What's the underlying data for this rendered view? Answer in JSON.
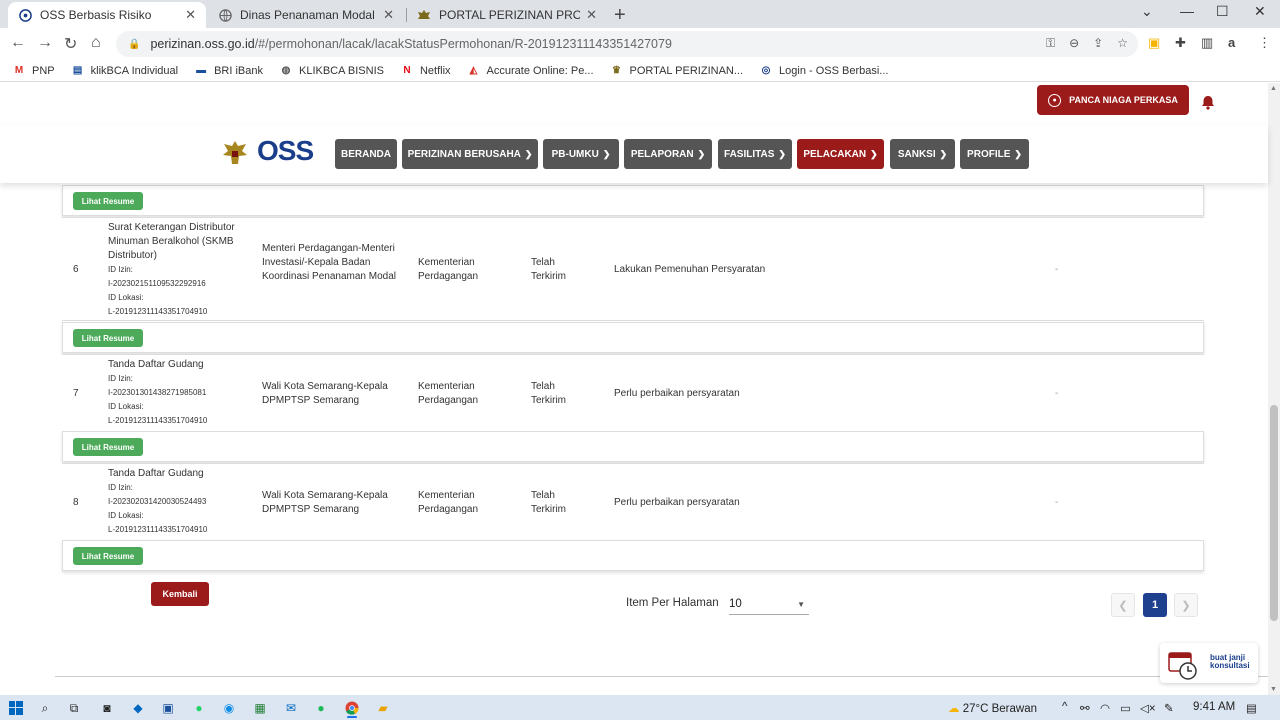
{
  "browser": {
    "tabs": [
      {
        "title": "OSS Berbasis Risiko",
        "active": true
      },
      {
        "title": "Dinas Penanaman Modal dan Pel",
        "active": false
      },
      {
        "title": "PORTAL PERIZINAN PROV JAWA",
        "active": false
      }
    ],
    "url_host": "perizinan.oss.go.id",
    "url_path": "/#/permohonan/lacak/lacakStatusPermohonan/R-201912311143351427079",
    "bookmarks": [
      "PNP",
      "klikBCA Individual",
      "BRI iBank",
      "KLIKBCA BISNIS",
      "Netflix",
      "Accurate Online: Pe...",
      "PORTAL PERIZINAN...",
      "Login - OSS Berbasi..."
    ]
  },
  "header": {
    "user_name": "PANCA NIAGA PERKASA",
    "logo_text": "OSS",
    "nav": [
      {
        "label": "BERANDA",
        "dropdown": false,
        "active": false
      },
      {
        "label": "PERIZINAN BERUSAHA",
        "dropdown": true,
        "active": false
      },
      {
        "label": "PB-UMKU",
        "dropdown": true,
        "active": false
      },
      {
        "label": "PELAPORAN",
        "dropdown": true,
        "active": false
      },
      {
        "label": "FASILITAS",
        "dropdown": true,
        "active": false
      },
      {
        "label": "PELACAKAN",
        "dropdown": true,
        "active": true
      },
      {
        "label": "SANKSI",
        "dropdown": true,
        "active": false
      },
      {
        "label": "PROFILE",
        "dropdown": true,
        "active": false
      }
    ]
  },
  "table": {
    "resume_label": "Lihat Resume",
    "rows": [
      {
        "no": "6",
        "name": "Surat Keterangan Distributor Minuman Beralkohol (SKMB Distributor)",
        "id_izin_label": "ID Izin:",
        "id_izin": "I-202302151109532292916",
        "id_lokasi_label": "ID Lokasi:",
        "id_lokasi": "L-201912311143351704910",
        "institution": "Menteri Perdagangan-Menteri Investasi/-Kepala Badan Koordinasi Penanaman Modal",
        "ministry": "Kementerian Perdagangan",
        "status": "Telah Terkirim",
        "note": "Lakukan Pemenuhan Persyaratan",
        "extra": "-"
      },
      {
        "no": "7",
        "name": "Tanda Daftar Gudang",
        "id_izin_label": "ID Izin:",
        "id_izin": "I-202301301438271985081",
        "id_lokasi_label": "ID Lokasi:",
        "id_lokasi": "L-201912311143351704910",
        "institution": "Wali Kota Semarang-Kepala DPMPTSP Semarang",
        "ministry": "Kementerian Perdagangan",
        "status": "Telah Terkirim",
        "note": "Perlu perbaikan persyaratan",
        "extra": "-"
      },
      {
        "no": "8",
        "name": "Tanda Daftar Gudang",
        "id_izin_label": "ID Izin:",
        "id_izin": "I-202302031420030524493",
        "id_lokasi_label": "ID Lokasi:",
        "id_lokasi": "L-201912311143351704910",
        "institution": "Wali Kota Semarang-Kepala DPMPTSP Semarang",
        "ministry": "Kementerian Perdagangan",
        "status": "Telah Terkirim",
        "note": "Perlu perbaikan persyaratan",
        "extra": "-"
      }
    ]
  },
  "footer": {
    "back_label": "Kembali",
    "per_page_label": "Item Per Halaman",
    "per_page_value": "10",
    "current_page": "1",
    "consult_line1": "buat janji",
    "consult_line2": "konsultasi"
  },
  "taskbar": {
    "weather": "27°C  Berawan",
    "time": "9:41 AM"
  },
  "colors": {
    "primary_red": "#9b1b1b",
    "nav_gray": "#555555",
    "resume_green": "#4caa5a",
    "oss_blue": "#1a3e8a",
    "page_active": "#1f3f8f"
  }
}
